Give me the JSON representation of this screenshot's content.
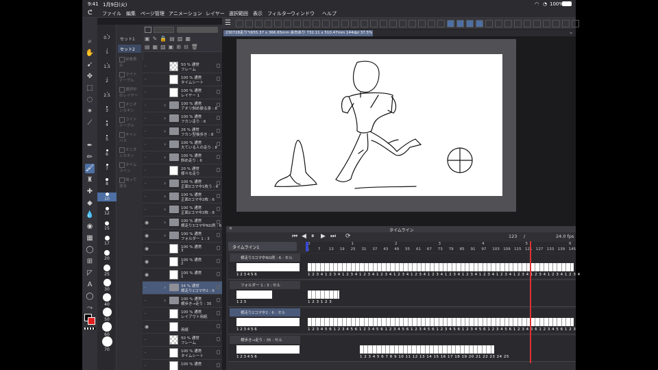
{
  "status": {
    "time": "9:41",
    "date": "1月9日(火)",
    "battery": "100%"
  },
  "menu": {
    "items": [
      "ファイル",
      "編集",
      "ページ管理",
      "アニメーション",
      "レイヤー",
      "選択範囲",
      "表示",
      "フィルター",
      "ウィンドウ",
      "ヘルプ"
    ]
  },
  "brushSizes": [
    "0.7",
    "1",
    "1.5",
    "2",
    "2.5",
    "3",
    "4",
    "5",
    "6",
    "7",
    "8",
    "10",
    "12",
    "15",
    "17",
    "20",
    "25",
    "30",
    "40",
    "50",
    "60",
    "70"
  ],
  "subtool": {
    "sets": [
      "セット1",
      "セット2"
    ],
    "items": [
      "前後表示",
      "ライトテーブル",
      "選択中のレイヤー",
      "オニオンスキン",
      "ライトテーブル",
      "キャンバス",
      "オニオンスキン",
      "タイムライン",
      "鳩って送る"
    ]
  },
  "layers": [
    {
      "line1": "50 % 通常",
      "line2": "フレーム",
      "type": "chk",
      "eye": false
    },
    {
      "line1": "100 % 通常",
      "line2": "タイムシート",
      "type": "img",
      "eye": false
    },
    {
      "line1": "100 % 通常",
      "line2": "レイヤー 1",
      "type": "img",
      "eye": false
    },
    {
      "line1": "100 % 通常",
      "line2": "アオリ斜め振る身 : 8",
      "type": "folder",
      "eye": false
    },
    {
      "line1": "100 % 通常",
      "line2": "フカン走り : 6",
      "type": "folder",
      "eye": false
    },
    {
      "line1": "26 % 通常",
      "line2": "フカン型後歩き : 8",
      "type": "folder",
      "eye": false
    },
    {
      "line1": "100 % 通常",
      "line2": "大ている人の走り : 8",
      "type": "folder",
      "eye": false
    },
    {
      "line1": "100 % 通常",
      "line2": "斜め走り : 6",
      "type": "folder",
      "eye": false
    },
    {
      "line1": "20 % 通常",
      "line2": "様々な走り",
      "type": "img",
      "eye": false
    },
    {
      "line1": "100 % 通常",
      "line2": "正面3コマ中1枚う : 6",
      "type": "folder",
      "eye": false
    },
    {
      "line1": "100 % 通常",
      "line2": "正面3コマ中2枚 : 6",
      "type": "folder",
      "eye": false
    },
    {
      "line1": "100 % 通常",
      "line2": "正面2コマ中2枚 : 8",
      "type": "folder",
      "eye": false
    },
    {
      "line1": "100 % 通常",
      "line2": "横走り3コマ中NG例 : 6",
      "type": "folder",
      "eye": true
    },
    {
      "line1": "100 % 通常",
      "line2": "フォルダー 1 : 3",
      "type": "folder",
      "eye": true
    },
    {
      "line1": "100 % 通常",
      "line2": "3",
      "type": "img",
      "eye": true
    },
    {
      "line1": "100 % 通常",
      "line2": "2",
      "type": "img",
      "eye": true
    },
    {
      "line1": "100 % 通常",
      "line2": "1",
      "type": "img",
      "eye": true
    },
    {
      "line1": "34 % 通常",
      "line2": "横走り2コマ中2 : 6",
      "type": "folder",
      "eye": false,
      "sel": true
    },
    {
      "line1": "100 % 通常",
      "line2": "横歩き→走り : 35",
      "type": "folder",
      "eye": false
    },
    {
      "line1": "100 % 通常",
      "line2": "レイアウト用紙",
      "type": "img",
      "eye": false
    },
    {
      "line1": "",
      "line2": "用紙",
      "type": "img",
      "eye": true
    },
    {
      "line1": "50 % 通常",
      "line2": "フレーム",
      "type": "chk",
      "eye": false
    },
    {
      "line1": "100 % 通常",
      "line2": "タイムシート",
      "type": "img",
      "eye": false
    },
    {
      "line1": "100 % 通常",
      "line2": "",
      "type": "img",
      "eye": false
    }
  ],
  "canvasTab": "230728走り*(655.37 x 366.65mm 余白あり 732.11 x 510.47mm 144dpi 37.5%)",
  "timeline": {
    "title": "タイムライン",
    "name": "タイムライン1",
    "frame": "123",
    "fps": "24.0 fps",
    "slash": "/",
    "rulerSeconds": [
      "0",
      "1",
      "2",
      "3",
      "4",
      "5",
      "6"
    ],
    "rulerFrames": [
      "1",
      "7",
      "13",
      "19",
      "25",
      "31",
      "37",
      "43",
      "49",
      "55",
      "61",
      "67",
      "73",
      "79",
      "85",
      "91",
      "97",
      "103",
      "109",
      "115",
      "121",
      "127",
      "133",
      "139",
      "145"
    ],
    "tracks": [
      {
        "name": "横走り3コマ中NG例 : 6 : セル",
        "left": "1  2  3  4  5  6",
        "right": "1 2 3 4 1 2 3 4 1 2 3 4 1 2 3 4 1 2 3 4 1 2 3 4 1 2 3 4 1 2 3 4 1 2 3 4 1 2 3 4 1 2 3 4 1 2 3 4 1 2 3 4 1 2 3 4 1 2 3 4 1 2 3 4"
      },
      {
        "name": "フォルダー 1 : 3 : セル",
        "left": "1  2  3",
        "right": "1 2 3 1 2 3"
      },
      {
        "name": "横走り2コマ中2 : 6 : セル",
        "left": "1  2  3  4  5  6",
        "right": "1 2 3 4 5 6 1 2 3 4 5 6 1 2 3 4 5 6 1 2 3 4 5 6 1 2 3 4 5 6 1 2 3 4 5 6 1 2 3 4 5 6 1 2 3 4 5 6 1 2 3 4 5 6 1 2 3 4 5 6 1 2 3"
      },
      {
        "name": "横歩き→走り : 35 : セル",
        "left": "1  2  3  4  5  6",
        "right": "1 2 3 4 5 6 7 8 9 10 11 12 13 14 15 16 17 18 19 20 21 22 23 24 25"
      }
    ]
  }
}
